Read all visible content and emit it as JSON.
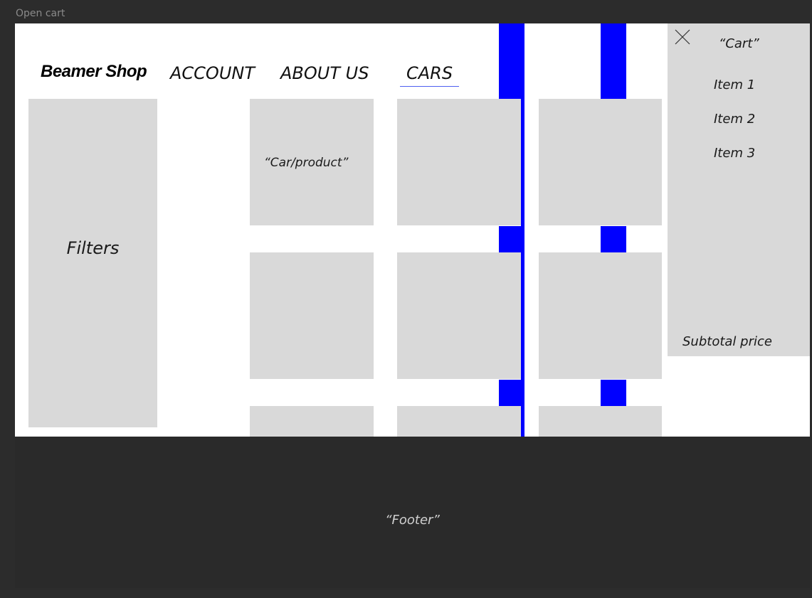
{
  "frame": {
    "label": "Open cart"
  },
  "header": {
    "logo": "Beamer Shop",
    "nav": [
      {
        "label": "ACCOUNT"
      },
      {
        "label": "ABOUT US"
      },
      {
        "label": "CARS"
      }
    ],
    "active_nav": "CARS"
  },
  "filters": {
    "label": "Filters"
  },
  "products": {
    "items": [
      {
        "label": "“Car/product”"
      },
      {
        "label": ""
      },
      {
        "label": ""
      },
      {
        "label": ""
      },
      {
        "label": ""
      },
      {
        "label": ""
      },
      {
        "label": ""
      },
      {
        "label": ""
      },
      {
        "label": ""
      }
    ]
  },
  "cart": {
    "title": "“Cart”",
    "close_icon": "close-icon",
    "items": [
      {
        "label": "Item 1"
      },
      {
        "label": "Item 2"
      },
      {
        "label": "Item 3"
      }
    ],
    "subtotal_label": "Subtotal price"
  },
  "footer": {
    "label": "“Footer”"
  },
  "colors": {
    "accent_blue": "#0000ff",
    "placeholder_gray": "#d9d9d9",
    "nav_underline": "#4d5ef0",
    "dark_background": "#2c2c2c"
  }
}
